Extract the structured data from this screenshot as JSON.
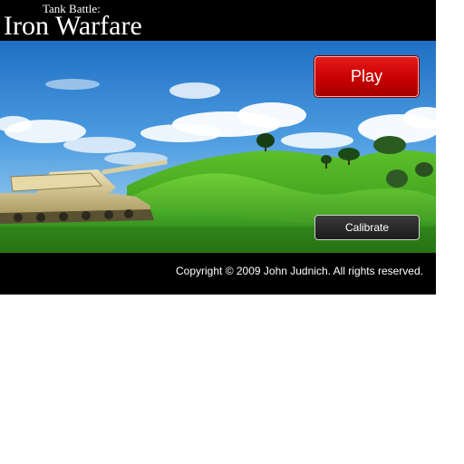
{
  "header": {
    "subtitle": "Tank Battle:",
    "title": "Iron Warfare"
  },
  "buttons": {
    "play_label": "Play",
    "calibrate_label": "Calibrate"
  },
  "footer": {
    "copyright": "Copyright © 2009 John Judnich. All rights reserved."
  },
  "colors": {
    "play_button": "#c90000",
    "calibrate_button": "#1c1c1c",
    "sky": "#3a8fd6",
    "grass": "#3fa51f",
    "frame": "#000000"
  }
}
